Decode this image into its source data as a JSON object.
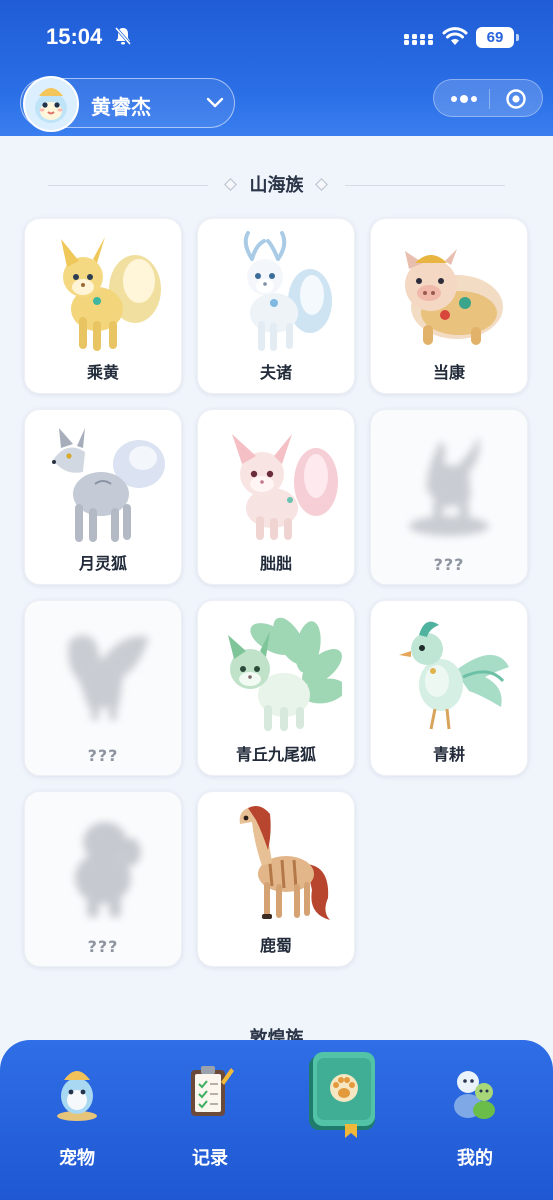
{
  "status_bar": {
    "time": "15:04",
    "battery": "69"
  },
  "header": {
    "user_name": "黄睿杰"
  },
  "section": {
    "title": "山海族"
  },
  "pets": [
    {
      "name": "乘黄"
    },
    {
      "name": "夫诸"
    },
    {
      "name": "当康"
    },
    {
      "name": "月灵狐"
    },
    {
      "name": "朏朏"
    },
    {
      "name": "???"
    },
    {
      "name": "???"
    },
    {
      "name": "青丘九尾狐"
    },
    {
      "name": "青耕"
    },
    {
      "name": "???"
    },
    {
      "name": "鹿蜀"
    }
  ],
  "next_section": {
    "title": "敦煌族"
  },
  "nav": {
    "pets": "宠物",
    "records": "记录",
    "mine": "我的"
  }
}
